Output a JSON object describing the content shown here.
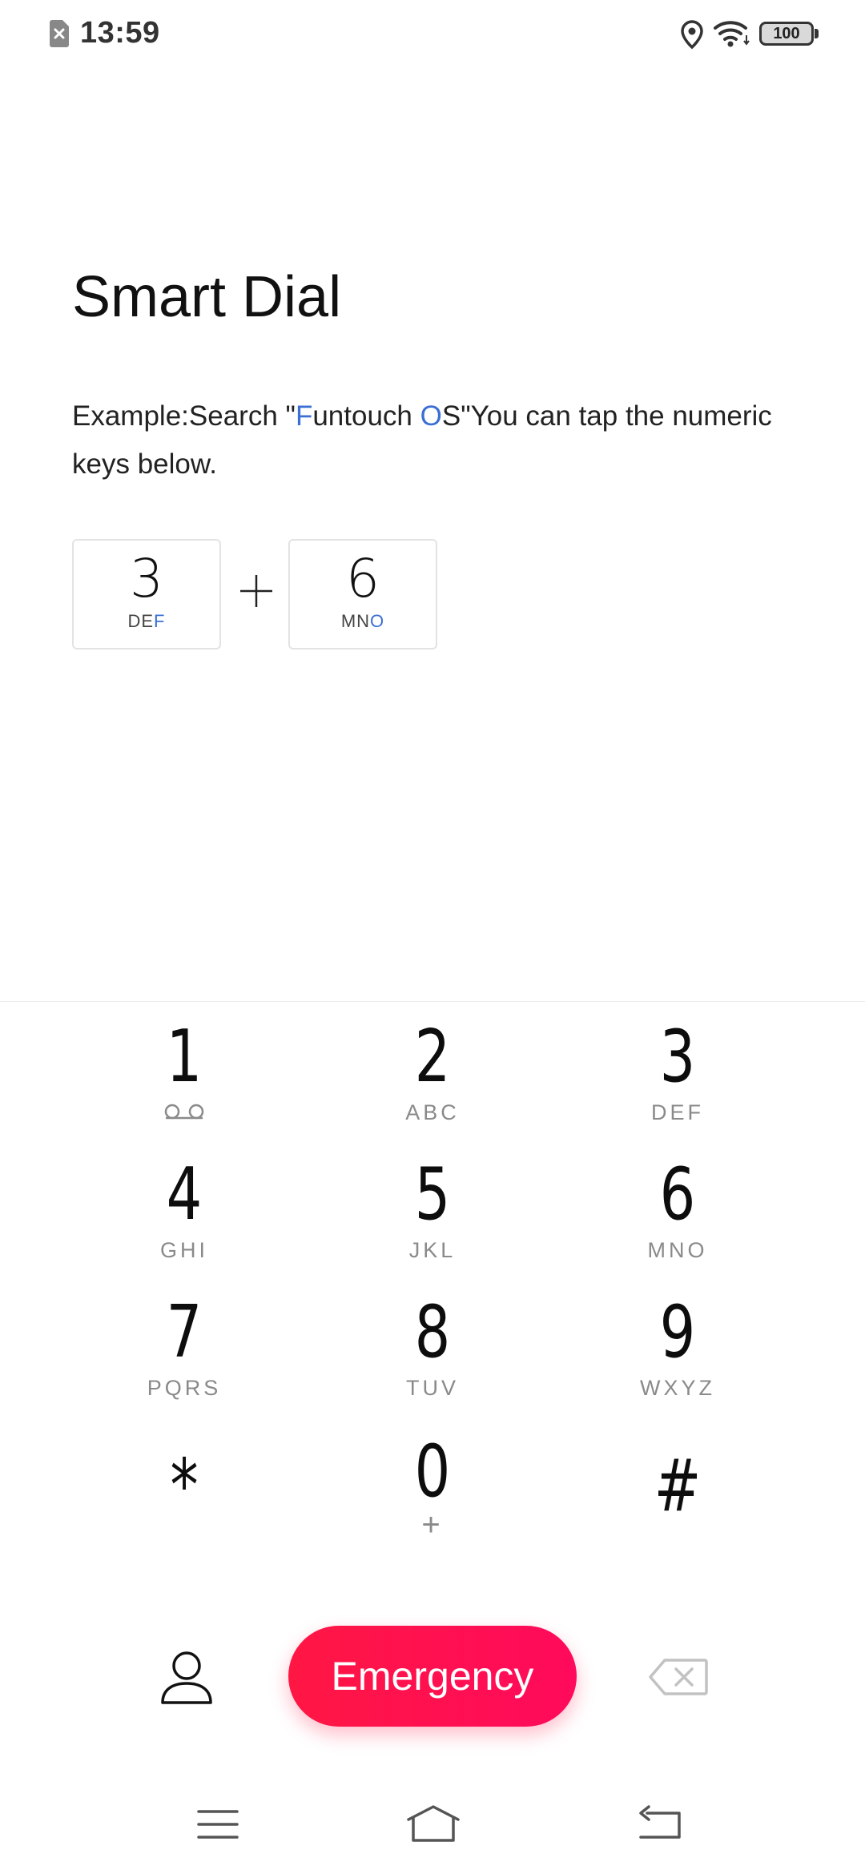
{
  "status_bar": {
    "time": "13:59",
    "battery": "100",
    "icons": [
      "sim-off-icon",
      "location-icon",
      "wifi-icon",
      "battery-icon"
    ]
  },
  "title": "Smart Dial",
  "example": {
    "prefix": "Example:Search \"",
    "hl1": "F",
    "mid": "untouch ",
    "hl2": "O",
    "suffix": "S\"You can tap the numeric keys below."
  },
  "example_keys": [
    {
      "digit": "3",
      "letters_plain": "DE",
      "letters_highlight": "F"
    },
    {
      "digit": "6",
      "letters_plain": "MN",
      "letters_highlight": "O"
    }
  ],
  "dialpad": [
    {
      "digit": "1",
      "sub": "",
      "icon": "voicemail-icon"
    },
    {
      "digit": "2",
      "sub": "ABC"
    },
    {
      "digit": "3",
      "sub": "DEF"
    },
    {
      "digit": "4",
      "sub": "GHI"
    },
    {
      "digit": "5",
      "sub": "JKL"
    },
    {
      "digit": "6",
      "sub": "MNO"
    },
    {
      "digit": "7",
      "sub": "PQRS"
    },
    {
      "digit": "8",
      "sub": "TUV"
    },
    {
      "digit": "9",
      "sub": "WXYZ"
    },
    {
      "digit": "*",
      "sub": ""
    },
    {
      "digit": "0",
      "sub": "+"
    },
    {
      "digit": "#",
      "sub": ""
    }
  ],
  "actions": {
    "emergency_label": "Emergency",
    "contact_icon": "contact-icon",
    "backspace_icon": "backspace-icon"
  },
  "nav_bar": {
    "icons": [
      "menu-icon",
      "home-icon",
      "back-icon"
    ]
  },
  "colors": {
    "accent_blue": "#3b6fd4",
    "emergency_red": "#ff1744",
    "text_primary": "#111111",
    "text_secondary": "#8a8a8a"
  }
}
